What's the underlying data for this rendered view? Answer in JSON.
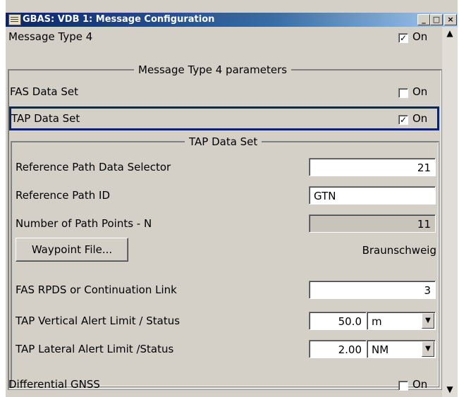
{
  "window": {
    "title": "GBAS: VDB 1: Message Configuration",
    "min_glyph": "_",
    "max_glyph": "□",
    "close_glyph": "×"
  },
  "msg4": {
    "label": "Message Type 4",
    "checked": true,
    "check_label": "On"
  },
  "group1": {
    "title": "Message Type 4 parameters"
  },
  "fas": {
    "label": "FAS Data Set",
    "checked": false,
    "check_label": "On"
  },
  "tap": {
    "label": "TAP Data Set",
    "checked": true,
    "check_label": "On"
  },
  "group2": {
    "title": "TAP Data Set"
  },
  "rpds": {
    "label": "Reference Path Data Selector",
    "value": "21"
  },
  "rpid": {
    "label": "Reference Path ID",
    "value": "GTN"
  },
  "npoints": {
    "label": "Number of Path Points - N",
    "value": "11"
  },
  "waypoint": {
    "button_label": "Waypoint File...",
    "file": "Braunschweig"
  },
  "fasrpds": {
    "label": "FAS RPDS or Continuation Link",
    "value": "3"
  },
  "tapv": {
    "label": "TAP Vertical Alert Limit / Status",
    "value": "50.0",
    "unit": "m"
  },
  "tapl": {
    "label": "TAP Lateral Alert Limit /Status",
    "value": "2.00",
    "unit": "NM"
  },
  "dgnss": {
    "label": "Differential GNSS",
    "checked": false,
    "check_label": "On"
  },
  "scroll": {
    "up_glyph": "▲",
    "down_glyph": "▼"
  },
  "combo_arrow_glyph": "▼",
  "check_glyph": "✓"
}
